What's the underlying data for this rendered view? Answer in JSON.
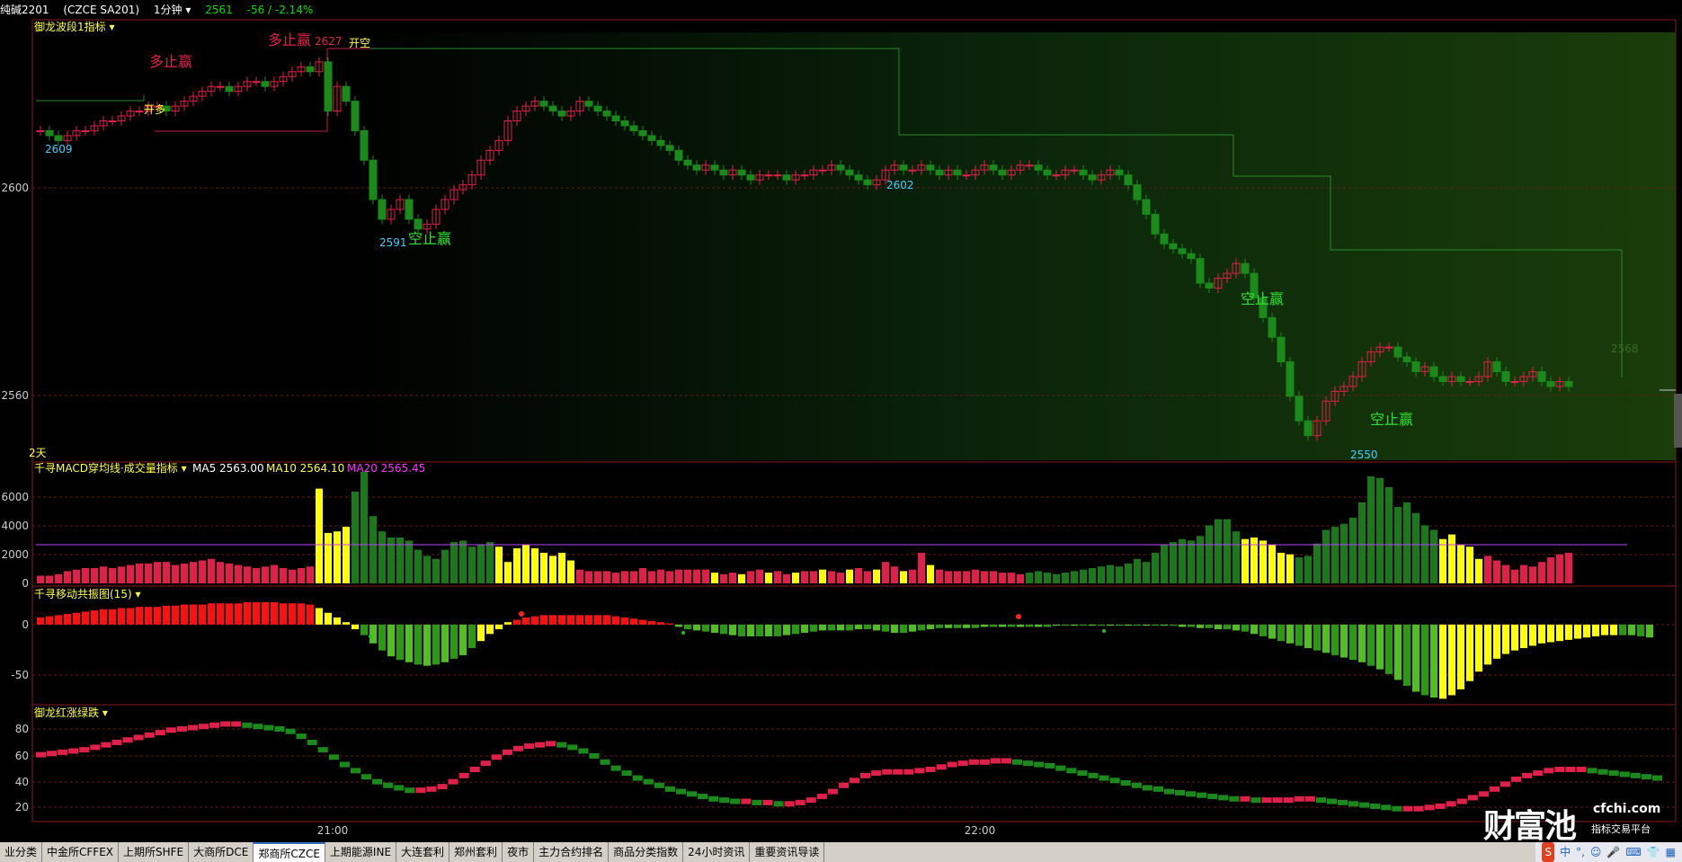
{
  "header": {
    "symbol": "纯碱2201",
    "code": "(CZCE SA201)",
    "period": "1分钟",
    "last": "2561",
    "change": "-56 / -2.14%"
  },
  "main_panel": {
    "indicator_title": "御龙波段1指标",
    "price_ticks": [
      "2600",
      "2560"
    ],
    "corner_label": "2天",
    "annotations": [
      {
        "text": "多止赢"
      },
      {
        "text": "多止赢"
      },
      {
        "text": "2627"
      },
      {
        "text": "开空"
      },
      {
        "text": "开多"
      },
      {
        "text": "2609"
      },
      {
        "text": "2591"
      },
      {
        "text": "空止赢"
      },
      {
        "text": "2602"
      },
      {
        "text": "空止赢"
      },
      {
        "text": "2568"
      },
      {
        "text": "空止赢"
      },
      {
        "text": "2550"
      }
    ]
  },
  "volume_panel": {
    "title": "千寻MACD穿均线·成交量指标",
    "ma5": "MA5 2563.00",
    "ma10": "MA10 2564.10",
    "ma20": "MA20 2565.45",
    "ticks": [
      "6000",
      "4000",
      "2000",
      "0"
    ]
  },
  "osc_panel": {
    "title": "千寻移动共振图(15)",
    "ticks": [
      "0",
      "-50"
    ]
  },
  "rg_panel": {
    "title": "御龙红涨绿跌",
    "ticks": [
      "80",
      "60",
      "40",
      "20"
    ]
  },
  "time_axis": [
    "21:00",
    "22:00"
  ],
  "tabs": [
    {
      "label": "业分类"
    },
    {
      "label": "中金所CFFEX"
    },
    {
      "label": "上期所SHFE"
    },
    {
      "label": "大商所DCE"
    },
    {
      "label": "郑商所CZCE"
    },
    {
      "label": "上期能源INE"
    },
    {
      "label": "大连套利"
    },
    {
      "label": "郑州套利"
    },
    {
      "label": "夜市"
    },
    {
      "label": "主力合约排名"
    },
    {
      "label": "商品分类指数"
    },
    {
      "label": "24小时资讯"
    },
    {
      "label": "重要资讯导读"
    }
  ],
  "tray": {
    "ime": "中"
  },
  "watermark": {
    "brand": "财富池",
    "url": "cfchi.com",
    "tagline": "指标交易平台"
  },
  "colors": {
    "up": "#e0204a",
    "down": "#1a8a1a",
    "yellow": "#ffff00",
    "cyan": "#40d0ff",
    "grid": "#7a1a1a"
  },
  "chart_data": [
    {
      "type": "candlestick",
      "y_range": [
        2545,
        2632
      ],
      "close": [
        2612,
        2611,
        2610,
        2611,
        2612,
        2612,
        2613,
        2614,
        2614,
        2615,
        2616,
        2616,
        2617,
        2617,
        2616,
        2617,
        2618,
        2619,
        2620,
        2621,
        2621,
        2620,
        2621,
        2622,
        2622,
        2621,
        2622,
        2623,
        2624,
        2625,
        2624,
        2626,
        2616,
        2621,
        2618,
        2612,
        2606,
        2598,
        2594,
        2596,
        2598,
        2594,
        2592,
        2593,
        2596,
        2598,
        2600,
        2601,
        2603,
        2606,
        2608,
        2610,
        2614,
        2616,
        2617,
        2618,
        2617,
        2616,
        2615,
        2616,
        2618,
        2617,
        2616,
        2615,
        2614,
        2613,
        2612,
        2611,
        2610,
        2609,
        2608,
        2606,
        2605,
        2604,
        2605,
        2604,
        2603,
        2604,
        2603,
        2602,
        2603,
        2603,
        2603,
        2602,
        2603,
        2603,
        2604,
        2604,
        2605,
        2604,
        2603,
        2602,
        2601,
        2602,
        2604,
        2605,
        2604,
        2604,
        2605,
        2604,
        2603,
        2604,
        2603,
        2603,
        2604,
        2605,
        2604,
        2603,
        2604,
        2605,
        2605,
        2604,
        2603,
        2603,
        2604,
        2604,
        2603,
        2602,
        2603,
        2604,
        2603,
        2601,
        2598,
        2595,
        2591,
        2589,
        2588,
        2587,
        2586,
        2581,
        2580,
        2582,
        2583,
        2585,
        2583,
        2578,
        2574,
        2570,
        2565,
        2558,
        2553,
        2550,
        2553,
        2557,
        2559,
        2560,
        2562,
        2565,
        2567,
        2568,
        2568,
        2566,
        2565,
        2563,
        2564,
        2562,
        2561,
        2562,
        2561,
        2561,
        2562,
        2565,
        2563,
        2561,
        2561,
        2562,
        2563,
        2561,
        2560,
        2561,
        2560
      ]
    },
    {
      "type": "bar",
      "y_range": [
        0,
        7000
      ],
      "values": [
        500,
        500,
        600,
        800,
        900,
        1000,
        1000,
        1100,
        1000,
        1100,
        1200,
        1300,
        1300,
        1400,
        1400,
        1200,
        1300,
        1400,
        1500,
        1600,
        1400,
        1300,
        1200,
        1100,
        1000,
        1100,
        1200,
        1000,
        900,
        1000,
        1100,
        6200,
        3300,
        3400,
        3700,
        6000,
        7300,
        4400,
        3400,
        3000,
        3000,
        2800,
        2200,
        1800,
        1600,
        2200,
        2700,
        2800,
        2400,
        2500,
        2700,
        2400,
        1400,
        2300,
        2500,
        2300,
        2000,
        1800,
        2000,
        1500,
        900,
        800,
        800,
        800,
        700,
        800,
        800,
        1000,
        800,
        900,
        800,
        900,
        900,
        900,
        900,
        700,
        600,
        700,
        600,
        800,
        900,
        700,
        800,
        600,
        700,
        800,
        800,
        900,
        800,
        700,
        900,
        1000,
        800,
        900,
        1400,
        1100,
        800,
        900,
        2000,
        1200,
        900,
        800,
        800,
        800,
        900,
        800,
        800,
        700,
        700,
        600,
        700,
        800,
        700,
        600,
        700,
        800,
        900,
        1000,
        1100,
        1200,
        1100,
        1300,
        1600,
        1400,
        2000,
        2500,
        2700,
        2900,
        2800,
        3100,
        3800,
        4200,
        4200,
        3400,
        2900,
        3000,
        2800,
        2500,
        2000,
        1900,
        1700,
        1800,
        2600,
        3500,
        3700,
        3900,
        4300,
        5300,
        7000,
        6900,
        6300,
        5000,
        5300,
        4600,
        3800,
        3500,
        2900,
        3200,
        2500,
        2400,
        1600,
        1800,
        1500,
        1200,
        900,
        1200,
        1100,
        1400,
        1700,
        1900,
        2000
      ]
    },
    {
      "type": "bar",
      "y_range": [
        -65,
        22
      ],
      "values": [
        6,
        7,
        8,
        9,
        10,
        11,
        12,
        13,
        13,
        14,
        14,
        15,
        15,
        15,
        16,
        16,
        17,
        17,
        17,
        18,
        18,
        18,
        18,
        19,
        19,
        19,
        19,
        18,
        18,
        18,
        17,
        14,
        10,
        6,
        2,
        -4,
        -9,
        -16,
        -22,
        -27,
        -30,
        -32,
        -34,
        -35,
        -34,
        -32,
        -29,
        -26,
        -20,
        -14,
        -8,
        -4,
        2,
        4,
        6,
        7,
        8,
        8,
        8,
        8,
        8,
        8,
        8,
        8,
        7,
        6,
        5,
        4,
        3,
        2,
        1,
        -2,
        -4,
        -5,
        -6,
        -7,
        -8,
        -9,
        -10,
        -10,
        -10,
        -10,
        -10,
        -9,
        -8,
        -7,
        -6,
        -5,
        -5,
        -5,
        -5,
        -4,
        -4,
        -5,
        -6,
        -7,
        -7,
        -6,
        -5,
        -4,
        -3,
        -3,
        -3,
        -3,
        -3,
        -2,
        -2,
        -2,
        -2,
        -2,
        -2,
        -2,
        -2,
        -1,
        -1,
        -1,
        -1,
        -1,
        -1,
        -1,
        -1,
        -1,
        -1,
        -1,
        -1,
        -1,
        -1,
        -2,
        -2,
        -3,
        -3,
        -4,
        -4,
        -5,
        -6,
        -8,
        -10,
        -12,
        -14,
        -16,
        -18,
        -20,
        -22,
        -24,
        -26,
        -28,
        -30,
        -32,
        -35,
        -38,
        -42,
        -47,
        -52,
        -57,
        -60,
        -62,
        -63,
        -60,
        -55,
        -48,
        -40,
        -34,
        -29,
        -25,
        -22,
        -20,
        -18,
        -16,
        -15,
        -14,
        -13,
        -12,
        -11,
        -10,
        -9,
        -9,
        -9,
        -9,
        -10,
        -11
      ]
    },
    {
      "type": "line",
      "y_range": [
        10,
        92
      ],
      "values": [
        63,
        64,
        65,
        66,
        67,
        69,
        71,
        73,
        75,
        77,
        79,
        81,
        83,
        84,
        85,
        86,
        87,
        88,
        88,
        87,
        86,
        85,
        84,
        82,
        78,
        73,
        67,
        61,
        55,
        50,
        45,
        41,
        38,
        36,
        34,
        34,
        35,
        37,
        41,
        46,
        51,
        56,
        61,
        65,
        68,
        70,
        71,
        72,
        71,
        69,
        66,
        62,
        57,
        52,
        48,
        44,
        41,
        38,
        35,
        33,
        31,
        29,
        27,
        26,
        25,
        25,
        24,
        24,
        23,
        23,
        24,
        26,
        29,
        33,
        38,
        42,
        46,
        48,
        49,
        49,
        49,
        50,
        51,
        53,
        55,
        56,
        57,
        57,
        58,
        58,
        57,
        56,
        55,
        54,
        52,
        50,
        48,
        46,
        44,
        42,
        40,
        38,
        36,
        35,
        33,
        32,
        31,
        30,
        29,
        28,
        27,
        27,
        26,
        26,
        26,
        26,
        27,
        27,
        26,
        25,
        24,
        23,
        22,
        21,
        20,
        19,
        19,
        19,
        20,
        21,
        23,
        25,
        28,
        31,
        35,
        39,
        43,
        46,
        48,
        50,
        51,
        51,
        51,
        50,
        49,
        48,
        47,
        46,
        45,
        44
      ]
    }
  ]
}
